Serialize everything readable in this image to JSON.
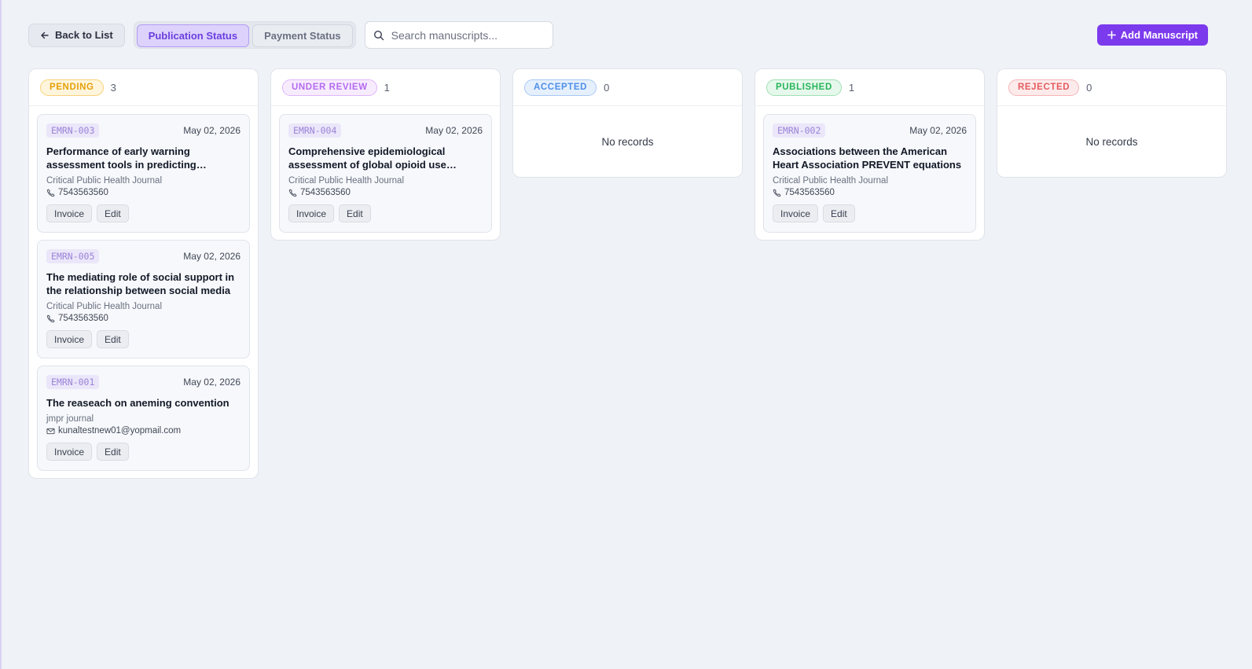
{
  "toolbar": {
    "back_label": "Back to List",
    "tabs": [
      {
        "label": "Publication Status",
        "active": true
      },
      {
        "label": "Payment Status",
        "active": false
      }
    ],
    "search_placeholder": "Search manuscripts...",
    "add_label": "Add Manuscript"
  },
  "colors": {
    "accent": "#7c3aed",
    "pending": "#f59e0b",
    "under_review": "#c084fc",
    "accepted": "#60a5fa",
    "published": "#22c55e",
    "rejected": "#f87171"
  },
  "columns": [
    {
      "status": "PENDING",
      "count": "3",
      "empty_text": "",
      "cards": [
        {
          "code": "EMRN-003",
          "date": "May 02, 2026",
          "title": "Performance of early warning assessment tools in predicting mortality",
          "journal": "Critical Public Health Journal",
          "contact_icon": "phone-icon",
          "contact": "7543563560",
          "invoice": "Invoice",
          "edit": "Edit"
        },
        {
          "code": "EMRN-005",
          "date": "May 02, 2026",
          "title": "The mediating role of social support in the relationship between social media",
          "journal": "Critical Public Health Journal",
          "contact_icon": "phone-icon",
          "contact": "7543563560",
          "invoice": "Invoice",
          "edit": "Edit"
        },
        {
          "code": "EMRN-001",
          "date": "May 02, 2026",
          "title": "The reaseach on aneming convention",
          "journal": "jmpr journal",
          "contact_icon": "mail-icon",
          "contact": "kunaltestnew01@yopmail.com",
          "invoice": "Invoice",
          "edit": "Edit"
        }
      ]
    },
    {
      "status": "UNDER REVIEW",
      "count": "1",
      "empty_text": "",
      "cards": [
        {
          "code": "EMRN-004",
          "date": "May 02, 2026",
          "title": "Comprehensive epidemiological assessment of global opioid use disorder",
          "journal": "Critical Public Health Journal",
          "contact_icon": "phone-icon",
          "contact": "7543563560",
          "invoice": "Invoice",
          "edit": "Edit"
        }
      ]
    },
    {
      "status": "ACCEPTED",
      "count": "0",
      "empty_text": "No records",
      "cards": []
    },
    {
      "status": "PUBLISHED",
      "count": "1",
      "empty_text": "",
      "cards": [
        {
          "code": "EMRN-002",
          "date": "May 02, 2026",
          "title": "Associations between the American Heart Association PREVENT equations",
          "journal": "Critical Public Health Journal",
          "contact_icon": "phone-icon",
          "contact": "7543563560",
          "invoice": "Invoice",
          "edit": "Edit"
        }
      ]
    },
    {
      "status": "REJECTED",
      "count": "0",
      "empty_text": "No records",
      "cards": []
    }
  ]
}
